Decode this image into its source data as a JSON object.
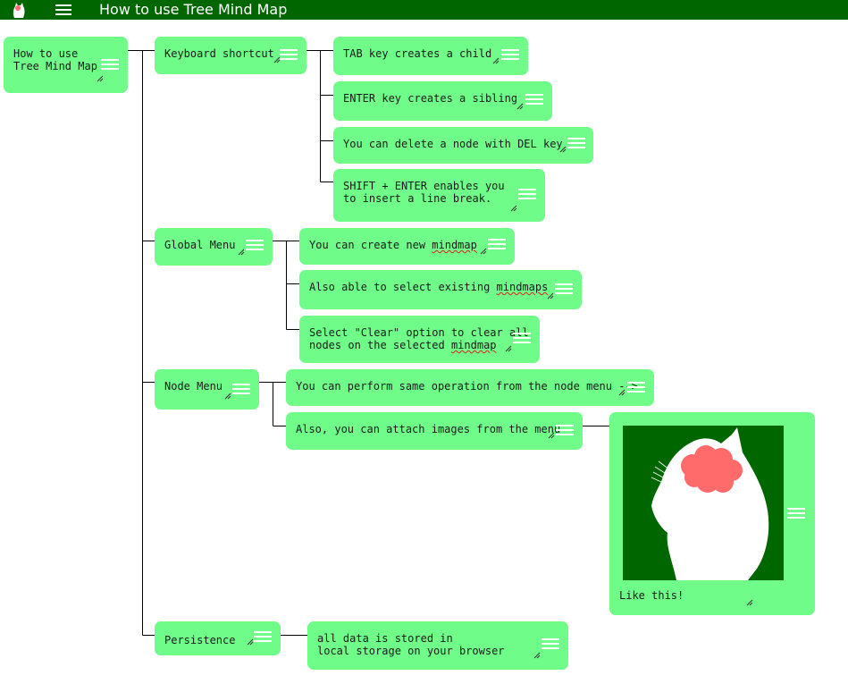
{
  "app": {
    "title": "How to use Tree Mind Map",
    "logo_icon": "cat-logo-icon",
    "menu_icon": "hamburger-menu-icon"
  },
  "colors": {
    "header": "#006600",
    "node": "#6ffc89",
    "line": "#000000",
    "image_bg": "#006600",
    "brain": "#ff6b6b"
  },
  "nodes": {
    "root": "How to use\nTree Mind Map",
    "keyboard": "Keyboard shortcut",
    "kb_tab": "TAB key creates a child",
    "kb_enter": "ENTER key creates a sibling",
    "kb_del": "You can delete a node with DEL key",
    "kb_shift": "SHIFT + ENTER enables you\nto insert a line break.",
    "global": "Global Menu",
    "gm_new_pre": "You can create new ",
    "gm_new_word": "mindmap",
    "gm_select_pre": "Also able to select existing ",
    "gm_select_word": "mindmaps",
    "gm_clear_l1": "Select \"Clear\" option to clear all",
    "gm_clear_l2_pre": "nodes on the selected ",
    "gm_clear_word": "mindmap",
    "nodemenu": "Node Menu",
    "nm_same": "You can perform same operation from the node menu -->",
    "nm_images": "Also, you can attach images from the menu",
    "nm_like": "Like this!",
    "persist": "Persistence",
    "persist_child": "all data is stored in\nlocal storage on your browser"
  }
}
